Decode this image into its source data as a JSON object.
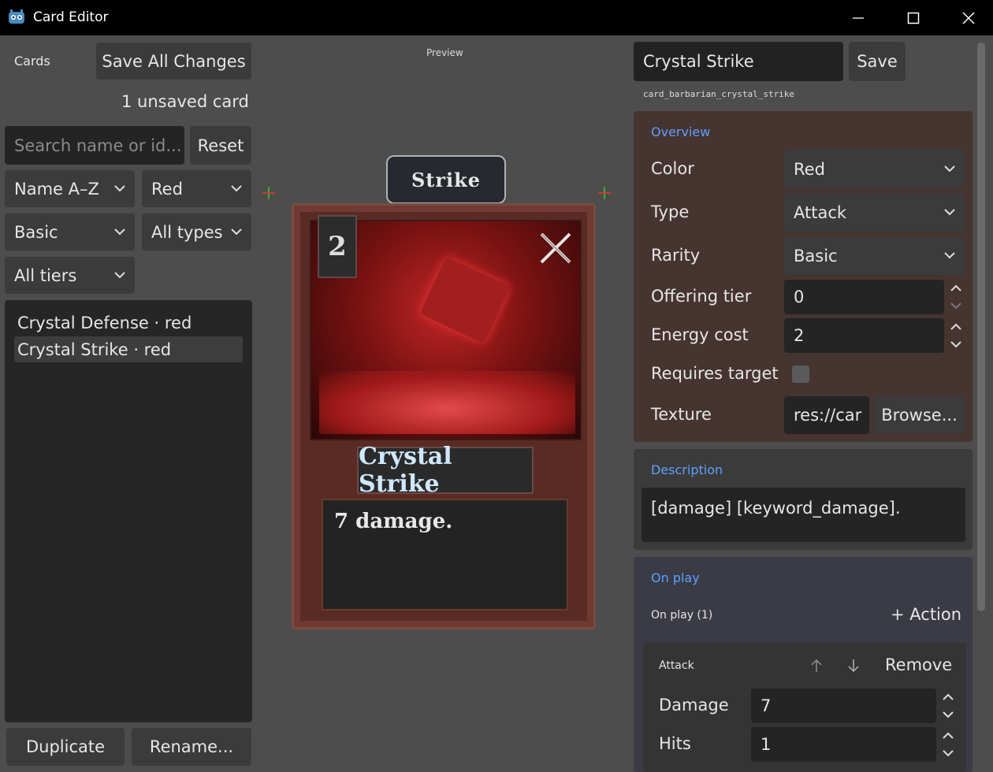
{
  "window": {
    "title": "Card Editor"
  },
  "left": {
    "cards_label": "Cards",
    "save_all": "Save All Changes",
    "unsaved_status": "1 unsaved card",
    "search_placeholder": "Search name or id...",
    "reset": "Reset",
    "sort": "Name A–Z",
    "color_filter": "Red",
    "rarity_filter": "Basic",
    "type_filter": "All types",
    "tier_filter": "All tiers",
    "items": [
      {
        "label": "Crystal Defense  ·  red"
      },
      {
        "label": "Crystal Strike  ·  red"
      }
    ],
    "duplicate": "Duplicate",
    "rename": "Rename..."
  },
  "preview": {
    "label": "Preview",
    "title_tag": "Strike",
    "cost": "2",
    "name": "Crystal Strike",
    "description": "7 damage."
  },
  "right": {
    "name_value": "Crystal Strike",
    "save": "Save",
    "card_id": "card_barbarian_crystal_strike",
    "overview": {
      "title": "Overview",
      "color_label": "Color",
      "color_value": "Red",
      "type_label": "Type",
      "type_value": "Attack",
      "rarity_label": "Rarity",
      "rarity_value": "Basic",
      "tier_label": "Offering tier",
      "tier_value": "0",
      "energy_label": "Energy cost",
      "energy_value": "2",
      "target_label": "Requires target",
      "requires_target": false,
      "texture_label": "Texture",
      "texture_value": "res://car",
      "browse": "Browse..."
    },
    "description": {
      "title": "Description",
      "value": "[damage] [keyword_damage]."
    },
    "on_play": {
      "title": "On play",
      "count_label": "On play  (1)",
      "add_action": "+ Action",
      "action": {
        "name": "Attack",
        "remove": "Remove",
        "damage_label": "Damage",
        "damage_value": "7",
        "hits_label": "Hits",
        "hits_value": "1"
      }
    }
  },
  "colors": {
    "overview_bg": "#463430",
    "accent": "#5ea0ff"
  }
}
